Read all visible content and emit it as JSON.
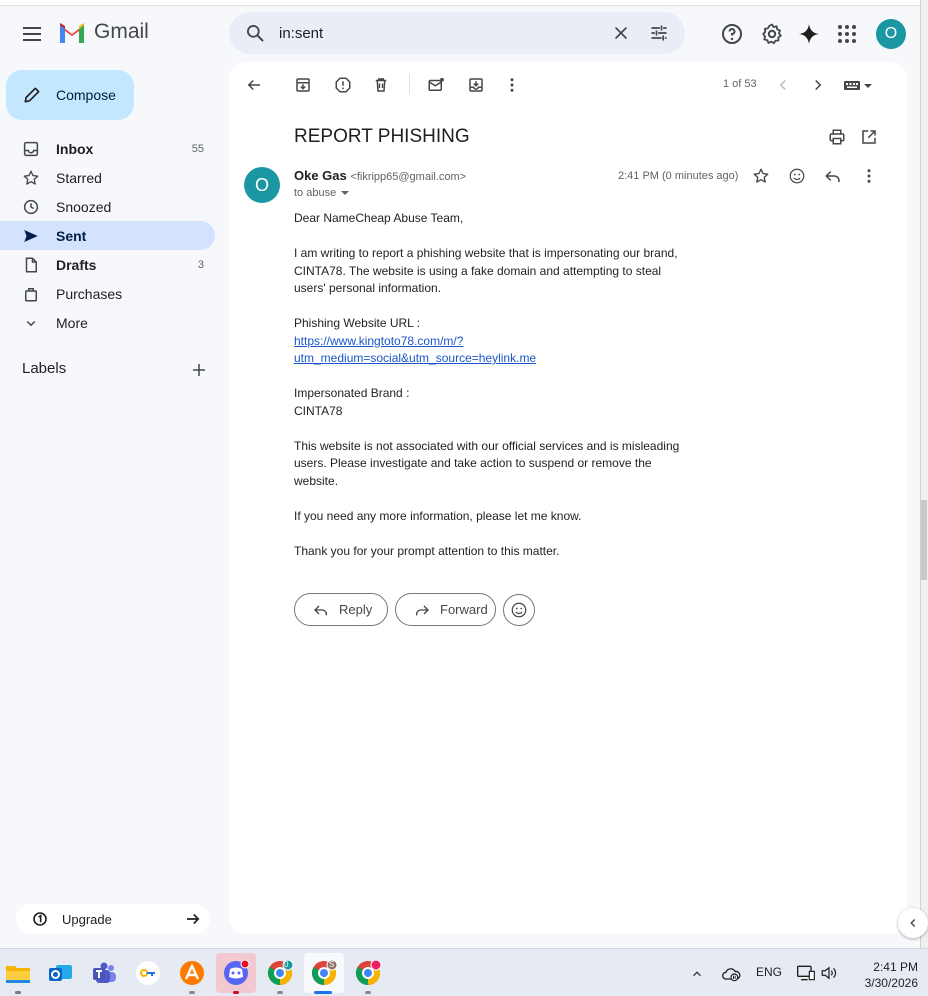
{
  "app": {
    "name": "Gmail"
  },
  "search": {
    "value": "in:sent"
  },
  "account": {
    "initial": "O"
  },
  "compose": {
    "label": "Compose"
  },
  "nav": [
    {
      "label": "Inbox",
      "count": "55",
      "icon": "inbox-icon"
    },
    {
      "label": "Starred",
      "count": "",
      "icon": "star-icon"
    },
    {
      "label": "Snoozed",
      "count": "",
      "icon": "clock-icon"
    },
    {
      "label": "Sent",
      "count": "",
      "icon": "send-icon"
    },
    {
      "label": "Drafts",
      "count": "3",
      "icon": "draft-icon"
    },
    {
      "label": "Purchases",
      "count": "",
      "icon": "shopping-bag-icon"
    },
    {
      "label": "More",
      "count": "",
      "icon": "chevron-down-icon"
    }
  ],
  "labels": {
    "title": "Labels"
  },
  "upgrade": {
    "label": "Upgrade"
  },
  "toolbar": {
    "pager": "1 of 53"
  },
  "email": {
    "subject": "REPORT PHISHING",
    "sender_initial": "O",
    "sender_name": "Oke Gas",
    "sender_email": "<fikripp65@gmail.com>",
    "to": "to abuse",
    "timestamp": "2:41 PM (0 minutes ago)",
    "greeting": "Dear NameCheap Abuse Team,",
    "para1": "I am writing to report a phishing website that is impersonating our brand, CINTA78. The website is using a fake domain and attempting to steal users' personal information.",
    "url_label": "Phishing Website URL :",
    "url": "https://www.kingtoto78.com/m/?utm_medium=social&utm_source=heylink.me",
    "brand_label": "Impersonated Brand :",
    "brand": "CINTA78",
    "para2": "This website is not associated with our official services and is misleading users. Please investigate and take action to suspend or remove the website.",
    "para3": "If you need any more information, please let me know.",
    "para4": "Thank you for your prompt attention to this matter."
  },
  "actions": {
    "reply": "Reply",
    "forward": "Forward"
  },
  "taskbar": {
    "language": "ENG",
    "time": "2:41 PM",
    "date": "3/30/2026",
    "badges": {
      "chrome1": "0",
      "chrome2": "S"
    }
  },
  "colors": {
    "accent": "#c2e7ff",
    "active_nav": "#d3e3fd",
    "avatar": "#1a97a2",
    "link": "#1a56c7"
  }
}
